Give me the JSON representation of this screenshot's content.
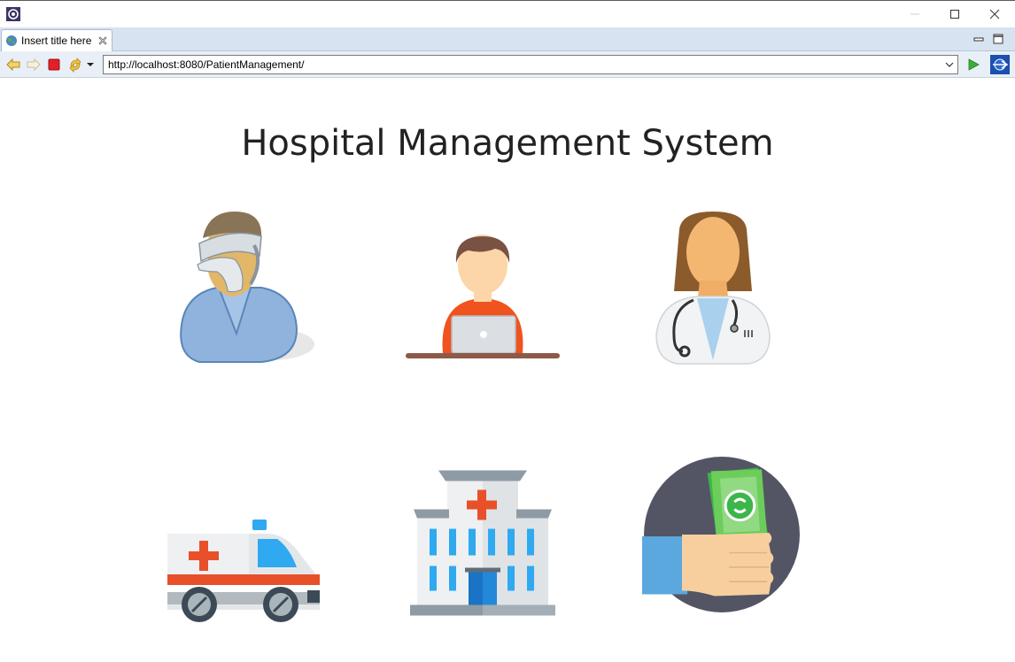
{
  "window": {
    "tab_title": "Insert title here"
  },
  "toolbar": {
    "url": "http://localhost:8080/PatientManagement/"
  },
  "main": {
    "title": "Hospital Management System",
    "tiles": [
      {
        "name": "patient-icon"
      },
      {
        "name": "receptionist-icon"
      },
      {
        "name": "doctor-icon"
      },
      {
        "name": "ambulance-icon"
      },
      {
        "name": "hospital-building-icon"
      },
      {
        "name": "payment-icon"
      }
    ]
  },
  "colors": {
    "tab_strip": "#d7e3f1",
    "toolbar_bg": "#e9eff7",
    "title_text": "#222222"
  }
}
